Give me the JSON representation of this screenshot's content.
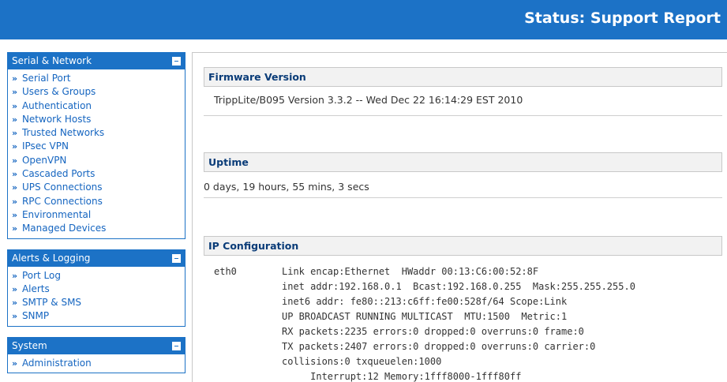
{
  "header": {
    "title": "Status: Support Report"
  },
  "sidebar": {
    "serial_network": {
      "title": "Serial & Network",
      "items": [
        "Serial Port",
        "Users & Groups",
        "Authentication",
        "Network Hosts",
        "Trusted Networks",
        "IPsec VPN",
        "OpenVPN",
        "Cascaded Ports",
        "UPS Connections",
        "RPC Connections",
        "Environmental",
        "Managed Devices"
      ]
    },
    "alerts_logging": {
      "title": "Alerts & Logging",
      "items": [
        "Port Log",
        "Alerts",
        "SMTP & SMS",
        "SNMP"
      ]
    },
    "system": {
      "title": "System",
      "items": [
        "Administration"
      ]
    },
    "bullet": "»"
  },
  "main": {
    "firmware": {
      "title": "Firmware Version",
      "text": "TrippLite/B095 Version 3.3.2 -- Wed Dec 22 16:14:29 EST 2010"
    },
    "uptime": {
      "title": "Uptime",
      "text": "0 days, 19 hours, 55 mins, 3 secs"
    },
    "ip_config": {
      "title": "IP Configuration",
      "iface": "eth0",
      "lines": [
        "Link encap:Ethernet  HWaddr 00:13:C6:00:52:8F",
        "inet addr:192.168.0.1  Bcast:192.168.0.255  Mask:255.255.255.0",
        "inet6 addr: fe80::213:c6ff:fe00:528f/64 Scope:Link",
        "UP BROADCAST RUNNING MULTICAST  MTU:1500  Metric:1",
        "RX packets:2235 errors:0 dropped:0 overruns:0 frame:0",
        "TX packets:2407 errors:0 dropped:0 overruns:0 carrier:0",
        "collisions:0 txqueuelen:1000",
        "     Interrupt:12 Memory:1fff8000-1fff80ff"
      ]
    }
  },
  "colors": {
    "brand_blue": "#1c72c6",
    "link": "#1565c0",
    "header_text": "#0a3c78"
  }
}
